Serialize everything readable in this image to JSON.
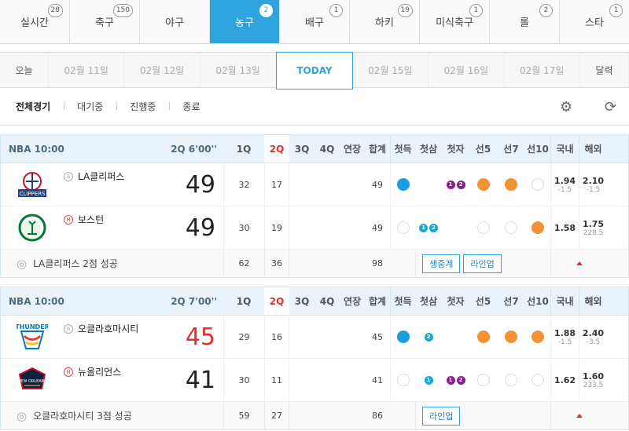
{
  "sports": [
    {
      "label": "실시간",
      "count": "28"
    },
    {
      "label": "축구",
      "count": "150"
    },
    {
      "label": "야구",
      "count": ""
    },
    {
      "label": "농구",
      "count": "2"
    },
    {
      "label": "배구",
      "count": "1"
    },
    {
      "label": "하키",
      "count": "19"
    },
    {
      "label": "미식축구",
      "count": "1"
    },
    {
      "label": "롤",
      "count": "2"
    },
    {
      "label": "스타",
      "count": "1"
    }
  ],
  "dates": {
    "first": "오늘",
    "d1": "02월 11일",
    "d2": "02월 12일",
    "d3": "02월 13일",
    "today": "TODAY",
    "d5": "02월 15일",
    "d6": "02월 16일",
    "d7": "02월 17일",
    "last": "달력"
  },
  "filters": {
    "all": "전체경기",
    "wait": "대기중",
    "live": "진행중",
    "end": "종료"
  },
  "header": {
    "q1": "1Q",
    "q2": "2Q",
    "q3": "3Q",
    "q4": "4Q",
    "ot": "연장",
    "total": "합계",
    "c1": "첫득",
    "c2": "첫삼",
    "c3": "첫자",
    "c4": "선5",
    "c5": "선7",
    "c6": "선10",
    "dom": "국내",
    "ovs": "해외"
  },
  "games": [
    {
      "league": "NBA  10:00",
      "time": "2Q 6'00''",
      "away": {
        "name": "LA클리퍼스",
        "badge": "A",
        "score": "49",
        "q1": "32",
        "q2": "17",
        "total": "49",
        "dom": "1.94",
        "dom_sub": "-1.5",
        "ovs": "2.10",
        "ovs_sub": "-1.5"
      },
      "home": {
        "name": "보스턴",
        "badge": "H",
        "score": "49",
        "q1": "30",
        "q2": "19",
        "total": "49",
        "dom": "1.58",
        "ovs": "1.75",
        "ovs_sub": "228.5"
      },
      "footer": {
        "text": "LA클리퍼스 2점 성공",
        "q1": "62",
        "q2": "36",
        "total": "98",
        "btn1": "생중계",
        "btn2": "라인업"
      }
    },
    {
      "league": "NBA  10:00",
      "time": "2Q 7'00''",
      "away": {
        "name": "오클라호마시티",
        "badge": "A",
        "score": "45",
        "q1": "29",
        "q2": "16",
        "total": "45",
        "dom": "1.88",
        "dom_sub": "-1.5",
        "ovs": "2.40",
        "ovs_sub": "-3.5"
      },
      "home": {
        "name": "뉴올리언스",
        "badge": "H",
        "score": "41",
        "q1": "30",
        "q2": "11",
        "total": "41",
        "dom": "1.62",
        "ovs": "1.60",
        "ovs_sub": "233.5"
      },
      "footer": {
        "text": "오클라호마시티 3점 성공",
        "q1": "59",
        "q2": "27",
        "total": "86",
        "btn1": "라인업"
      }
    }
  ],
  "logos": {
    "clippers": "CLIPPERS",
    "thunder": "THUNDER",
    "pelicans": "NEW ORLEANS"
  },
  "mini": {
    "one": "1",
    "two": "2"
  }
}
